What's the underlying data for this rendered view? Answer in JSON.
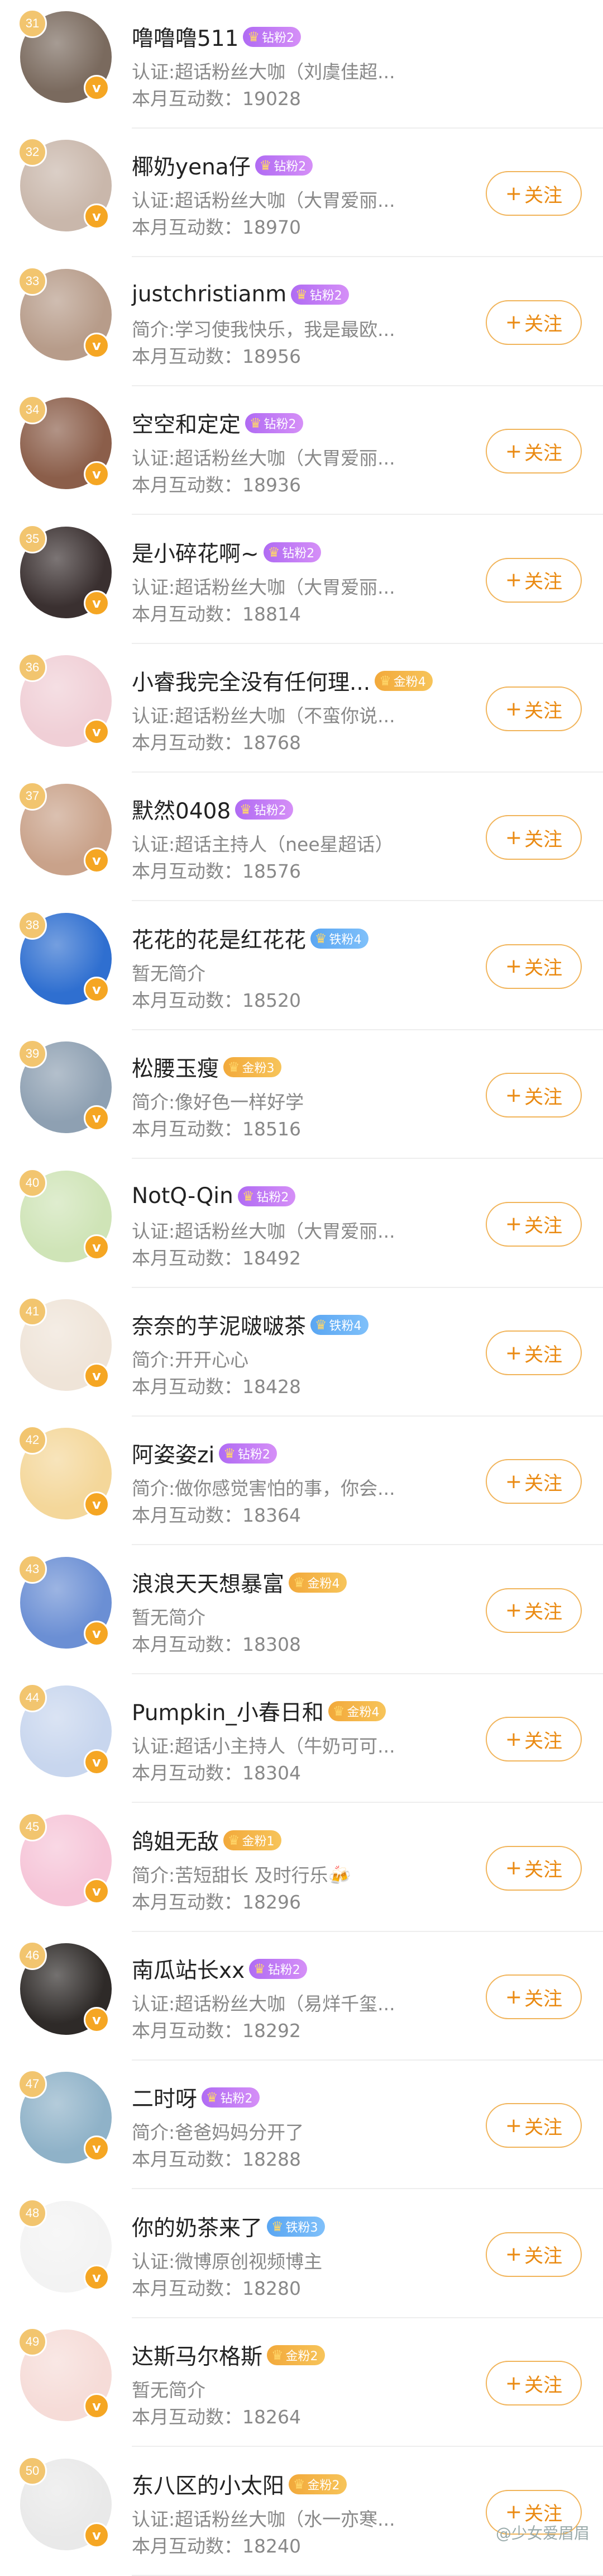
{
  "follow_label": "关注",
  "watermark": "@少女爱眉眉",
  "rows": [
    {
      "rank": "31",
      "name": "噜噜噜511",
      "badge": "钻粉2",
      "badge_color": "purple",
      "sub": "认证:超话粉丝大咖（刘虞佳超...",
      "count": "本月互动数：19028",
      "follow": false,
      "avatar_color": "#7a6a5e"
    },
    {
      "rank": "32",
      "name": "椰奶yena仔",
      "badge": "钻粉2",
      "badge_color": "purple",
      "sub": "认证:超话粉丝大咖（大胃爱丽...",
      "count": "本月互动数：18970",
      "follow": true,
      "avatar_color": "#c9b7ab"
    },
    {
      "rank": "33",
      "name": "justchristianm",
      "badge": "钻粉2",
      "badge_color": "purple",
      "sub": "简介:学习使我快乐，我是最欧...",
      "count": "本月互动数：18956",
      "follow": true,
      "avatar_color": "#b79c8a"
    },
    {
      "rank": "34",
      "name": "空空和定定",
      "badge": "钻粉2",
      "badge_color": "purple",
      "sub": "认证:超话粉丝大咖（大胃爱丽...",
      "count": "本月互动数：18936",
      "follow": true,
      "avatar_color": "#8b5e4a"
    },
    {
      "rank": "35",
      "name": "是小碎花啊~",
      "badge": "钻粉2",
      "badge_color": "purple",
      "sub": "认证:超话粉丝大咖（大胃爱丽...",
      "count": "本月互动数：18814",
      "follow": true,
      "avatar_color": "#3a3030"
    },
    {
      "rank": "36",
      "name": "小睿我完全没有任何理...",
      "badge": "金粉4",
      "badge_color": "gold",
      "sub": "认证:超话粉丝大咖（不蛮你说...",
      "count": "本月互动数：18768",
      "follow": true,
      "avatar_color": "#f0cfd6"
    },
    {
      "rank": "37",
      "name": "默然0408",
      "badge": "钻粉2",
      "badge_color": "purple",
      "sub": "认证:超话主持人（nee星超话）",
      "count": "本月互动数：18576",
      "follow": true,
      "avatar_color": "#c9a28a"
    },
    {
      "rank": "38",
      "name": "花花的花是红花花",
      "badge": "铁粉4",
      "badge_color": "blue",
      "sub": "暂无简介",
      "count": "本月互动数：18520",
      "follow": true,
      "avatar_color": "#2f6fd0"
    },
    {
      "rank": "39",
      "name": "松腰玉瘦",
      "badge": "金粉3",
      "badge_color": "gold",
      "sub": "简介:像好色一样好学",
      "count": "本月互动数：18516",
      "follow": true,
      "avatar_color": "#8ea0b2"
    },
    {
      "rank": "40",
      "name": "NotQ-Qin",
      "badge": "钻粉2",
      "badge_color": "purple",
      "sub": "认证:超话粉丝大咖（大胃爱丽...",
      "count": "本月互动数：18492",
      "follow": true,
      "avatar_color": "#cfe4b7"
    },
    {
      "rank": "41",
      "name": "奈奈的芋泥啵啵茶",
      "badge": "铁粉4",
      "badge_color": "blue",
      "sub": "简介:开开心心",
      "count": "本月互动数：18428",
      "follow": true,
      "avatar_color": "#efe4d8"
    },
    {
      "rank": "42",
      "name": "阿姿姿zi",
      "badge": "钻粉2",
      "badge_color": "purple",
      "sub": "简介:做你感觉害怕的事，你会...",
      "count": "本月互动数：18364",
      "follow": true,
      "avatar_color": "#f4d79a"
    },
    {
      "rank": "43",
      "name": "浪浪天天想暴富",
      "badge": "金粉4",
      "badge_color": "gold",
      "sub": "暂无简介",
      "count": "本月互动数：18308",
      "follow": true,
      "avatar_color": "#6b8fd4"
    },
    {
      "rank": "44",
      "name": "Pumpkin_小春日和",
      "badge": "金粉4",
      "badge_color": "gold",
      "sub": "认证:超话小主持人（牛奶可可...",
      "count": "本月互动数：18304",
      "follow": true,
      "avatar_color": "#c8d6ee"
    },
    {
      "rank": "45",
      "name": "鸽姐无敌",
      "badge": "金粉1",
      "badge_color": "gold",
      "sub": "简介:苦短甜长 及时行乐🍻",
      "count": "本月互动数：18296",
      "follow": true,
      "avatar_color": "#f6c5d8"
    },
    {
      "rank": "46",
      "name": "南瓜站长xx",
      "badge": "钻粉2",
      "badge_color": "purple",
      "sub": "认证:超话粉丝大咖（易烊千玺...",
      "count": "本月互动数：18292",
      "follow": true,
      "avatar_color": "#2e2a28"
    },
    {
      "rank": "47",
      "name": "二时呀",
      "badge": "钻粉2",
      "badge_color": "purple",
      "sub": "简介:爸爸妈妈分开了",
      "count": "本月互动数：18288",
      "follow": true,
      "avatar_color": "#8fb2c8"
    },
    {
      "rank": "48",
      "name": "你的奶茶来了",
      "badge": "铁粉3",
      "badge_color": "blue",
      "sub": "认证:微博原创视频博主",
      "count": "本月互动数：18280",
      "follow": true,
      "avatar_color": "#f3f3f3"
    },
    {
      "rank": "49",
      "name": "达斯马尔格斯",
      "badge": "金粉2",
      "badge_color": "gold",
      "sub": "暂无简介",
      "count": "本月互动数：18264",
      "follow": true,
      "avatar_color": "#f6dcd8"
    },
    {
      "rank": "50",
      "name": "东八区的小太阳",
      "badge": "金粉2",
      "badge_color": "gold",
      "sub": "认证:超话粉丝大咖（水一亦寒...",
      "count": "本月互动数：18240",
      "follow": true,
      "avatar_color": "#e9e9e9"
    }
  ]
}
